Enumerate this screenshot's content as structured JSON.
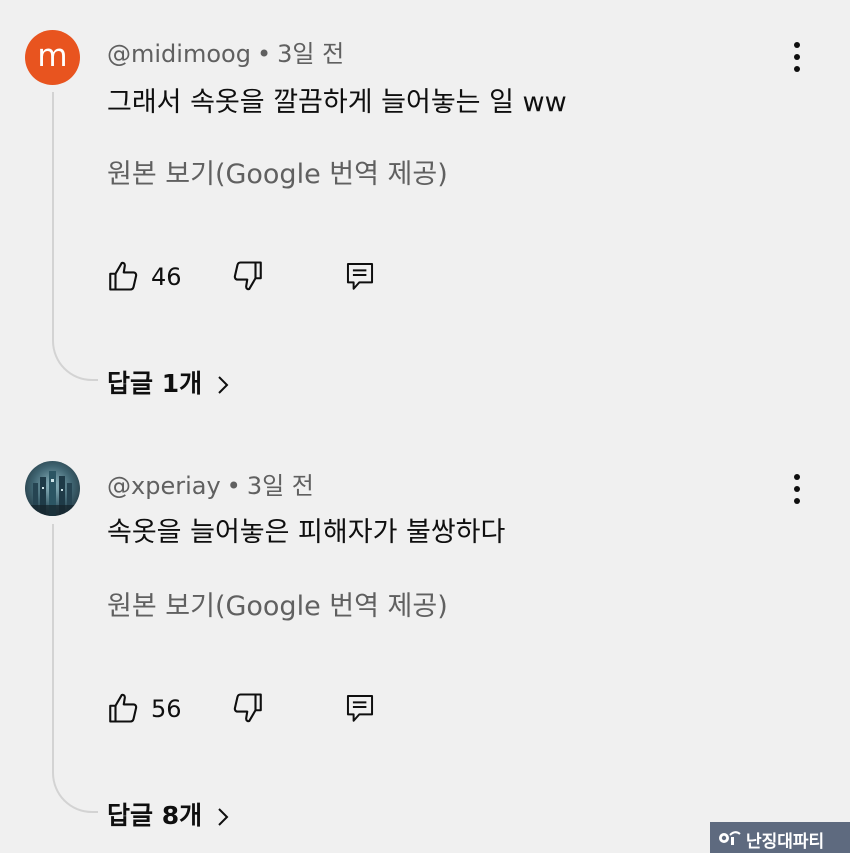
{
  "comments": [
    {
      "avatar_letter": "m",
      "avatar_color": "#e8541f",
      "username": "@midimoog",
      "separator": "•",
      "time": "3일 전",
      "text": "그래서 속옷을 깔끔하게 늘어놓는 일 ww",
      "translate_label": "원본 보기(Google 번역 제공)",
      "like_count": "46",
      "replies_label": "답글 1개"
    },
    {
      "avatar_image": "profile-photo",
      "username": "@xperiay",
      "separator": "•",
      "time": "3일 전",
      "text": "속옷을 늘어놓은 피해자가 불쌍하다",
      "translate_label": "원본 보기(Google 번역 제공)",
      "like_count": "56",
      "replies_label": "답글 8개"
    }
  ],
  "icons": {
    "like": "thumbs-up-icon",
    "dislike": "thumbs-down-icon",
    "reply": "reply-comment-icon",
    "more": "more-vert-icon",
    "replies_chevron": "chevron-right-icon"
  },
  "watermark": {
    "text": "난징대파티"
  },
  "colors": {
    "background": "#f0f0f0",
    "primary_text": "#0f0f0f",
    "secondary_text": "#606060",
    "avatar_orange": "#e8541f",
    "watermark_bg": "#5e6a7f"
  }
}
